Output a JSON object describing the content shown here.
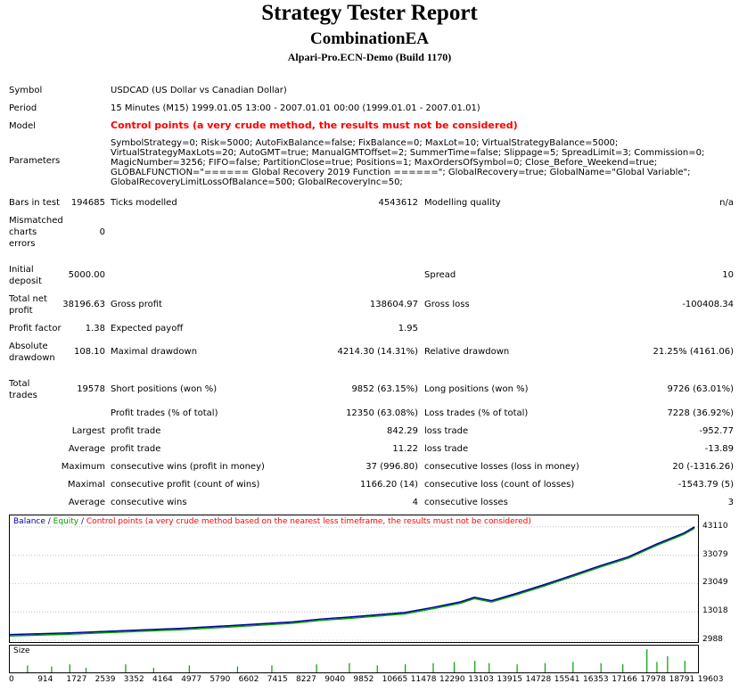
{
  "header": {
    "title": "Strategy Tester Report",
    "ea_name": "CombinationEA",
    "server": "Alpari-Pro.ECN-Demo (Build 1170)"
  },
  "info": {
    "symbol_label": "Symbol",
    "symbol_value": "USDCAD (US Dollar vs Canadian Dollar)",
    "period_label": "Period",
    "period_value": "15 Minutes (M15) 1999.01.05 13:00 - 2007.01.01 00:00 (1999.01.01 - 2007.01.01)",
    "model_label": "Model",
    "model_value": "Control points (a very crude method, the results must not be considered)",
    "parameters_label": "Parameters",
    "parameters_value": "SymbolStrategy=0; Risk=5000; AutoFixBalance=false; FixBalance=0; MaxLot=10; VirtualStrategyBalance=5000; VirtualStrategyMaxLots=20; AutoGMT=true; ManualGMTOffset=2; SummerTime=false; Slippage=5; SpreadLimit=3; Commission=0; MagicNumber=3256; FIFO=false; PartitionClose=true; Positions=1; MaxOrdersOfSymbol=0; Close_Before_Weekend=true; GLOBALFUNCTION=\"====== Global Recovery 2019 Function ======\"; GlobalRecovery=true; GlobalName=\"Global Variable\"; GlobalRecoveryLimitLossOfBalance=500; GlobalRecoveryInc=50;"
  },
  "stats": {
    "bars_label": "Bars in test",
    "bars_value": "194685",
    "ticks_label": "Ticks modelled",
    "ticks_value": "4543612",
    "quality_label": "Modelling quality",
    "quality_value": "n/a",
    "mismatch_label1": "Mismatched",
    "mismatch_label2": "charts",
    "mismatch_label3": "errors",
    "mismatch_value": "0",
    "deposit_label1": "Initial",
    "deposit_label2": "deposit",
    "deposit_value": "5000.00",
    "spread_label": "Spread",
    "spread_value": "10",
    "netprofit_label1": "Total net",
    "netprofit_label2": "profit",
    "netprofit_value": "38196.63",
    "grossprofit_label": "Gross profit",
    "grossprofit_value": "138604.97",
    "grossloss_label": "Gross loss",
    "grossloss_value": "-100408.34",
    "pf_label": "Profit factor",
    "pf_value": "1.38",
    "payoff_label": "Expected payoff",
    "payoff_value": "1.95",
    "absdd_label1": "Absolute",
    "absdd_label2": "drawdown",
    "absdd_value": "108.10",
    "maxdd_label": "Maximal drawdown",
    "maxdd_value": "4214.30 (14.31%)",
    "reldd_label": "Relative drawdown",
    "reldd_value": "21.25% (4161.06)",
    "trades_label1": "Total",
    "trades_label2": "trades",
    "trades_value": "19578",
    "short_label": "Short positions (won %)",
    "short_value": "9852 (63.15%)",
    "long_label": "Long positions (won %)",
    "long_value": "9726 (63.01%)",
    "profittrades_label": "Profit trades (% of total)",
    "profittrades_value": "12350 (63.08%)",
    "losstrades_label": "Loss trades (% of total)",
    "losstrades_value": "7228 (36.92%)",
    "largest_label": "Largest",
    "largest_profit_label": "profit trade",
    "largest_profit_value": "842.29",
    "largest_loss_label": "loss trade",
    "largest_loss_value": "-952.77",
    "average_label": "Average",
    "average_profit_label": "profit trade",
    "average_profit_value": "11.22",
    "average_loss_label": "loss trade",
    "average_loss_value": "-13.89",
    "maximum_label": "Maximum",
    "max_wins_label": "consecutive wins (profit in money)",
    "max_wins_value": "37 (996.80)",
    "max_losses_label": "consecutive losses (loss in money)",
    "max_losses_value": "20 (-1316.26)",
    "maximal_label": "Maximal",
    "maximal_profit_label": "consecutive profit (count of wins)",
    "maximal_profit_value": "1166.20 (14)",
    "maximal_loss_label": "consecutive loss (count of losses)",
    "maximal_loss_value": "-1543.79 (5)",
    "avg_label": "Average",
    "avg_wins_label": "consecutive wins",
    "avg_wins_value": "4",
    "avg_losses_label": "consecutive losses",
    "avg_losses_value": "3"
  },
  "chart_legend": {
    "balance": "Balance",
    "sep1": " / ",
    "equity": "Equity",
    "sep2": " / ",
    "note": "Control points (a very crude method based on the nearest less timeframe, the results must not be considered)",
    "size_label": "Size"
  },
  "colors": {
    "balance": "#0000a0",
    "equity": "#00a000",
    "note": "#ff0000",
    "size_bars": "#00a000"
  },
  "chart_data": {
    "type": "line",
    "series": [
      {
        "name": "Balance",
        "x": [
          0,
          1727,
          3352,
          4977,
          6602,
          8227,
          9040,
          9852,
          11478,
          12290,
          13103,
          13500,
          14000,
          14728,
          15541,
          16353,
          17166,
          17978,
          18791,
          19603,
          19900
        ],
        "values": [
          5000,
          5600,
          6400,
          7200,
          8300,
          9500,
          10500,
          11200,
          12800,
          14600,
          16600,
          18200,
          17000,
          19600,
          22700,
          26000,
          29400,
          32500,
          37000,
          41000,
          43110
        ]
      }
    ],
    "y_ticks": [
      "43110",
      "33079",
      "23049",
      "13018",
      "2988"
    ],
    "x_ticks": [
      "0",
      "914",
      "1727",
      "2539",
      "3352",
      "4164",
      "4977",
      "5790",
      "6602",
      "7415",
      "8227",
      "9040",
      "9852",
      "10665",
      "11478",
      "12290",
      "13103",
      "13915",
      "14728",
      "15541",
      "16353",
      "17166",
      "17978",
      "18791",
      "19603"
    ],
    "ylim": [
      2988,
      44000
    ],
    "xlim": [
      0,
      20000
    ],
    "size_bars": [
      {
        "x": 500,
        "v": 0.3
      },
      {
        "x": 1200,
        "v": 0.25
      },
      {
        "x": 1727,
        "v": 0.35
      },
      {
        "x": 2200,
        "v": 0.2
      },
      {
        "x": 3352,
        "v": 0.35
      },
      {
        "x": 4164,
        "v": 0.2
      },
      {
        "x": 5200,
        "v": 0.3
      },
      {
        "x": 6602,
        "v": 0.25
      },
      {
        "x": 7600,
        "v": 0.3
      },
      {
        "x": 8900,
        "v": 0.35
      },
      {
        "x": 9852,
        "v": 0.4
      },
      {
        "x": 10665,
        "v": 0.3
      },
      {
        "x": 11478,
        "v": 0.35
      },
      {
        "x": 12290,
        "v": 0.4
      },
      {
        "x": 12900,
        "v": 0.45
      },
      {
        "x": 13500,
        "v": 0.5
      },
      {
        "x": 13915,
        "v": 0.4
      },
      {
        "x": 14728,
        "v": 0.35
      },
      {
        "x": 15541,
        "v": 0.4
      },
      {
        "x": 16353,
        "v": 0.45
      },
      {
        "x": 17166,
        "v": 0.4
      },
      {
        "x": 17800,
        "v": 0.35
      },
      {
        "x": 18500,
        "v": 1.0
      },
      {
        "x": 18791,
        "v": 0.45
      },
      {
        "x": 19100,
        "v": 0.7
      },
      {
        "x": 19603,
        "v": 0.5
      }
    ]
  }
}
